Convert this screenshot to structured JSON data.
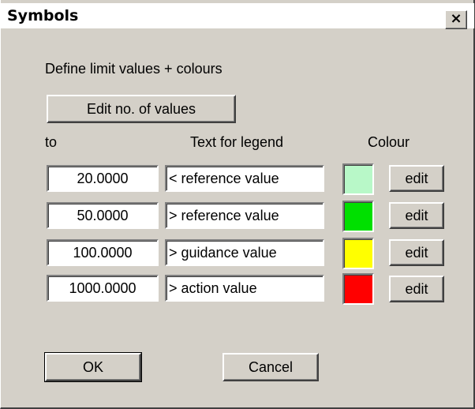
{
  "window": {
    "title": "Symbols",
    "close_label": "×"
  },
  "heading": "Define limit values + colours",
  "edit_values_label": "Edit no. of values",
  "columns": {
    "to": "to",
    "legend": "Text for legend",
    "colour": "Colour"
  },
  "rows": [
    {
      "to": "20.0000",
      "legend": "< reference value",
      "colour": "#b8f8c8",
      "edit_label": "edit"
    },
    {
      "to": "50.0000",
      "legend": "> reference value",
      "colour": "#00e000",
      "edit_label": "edit"
    },
    {
      "to": "100.0000",
      "legend": "> guidance value",
      "colour": "#ffff00",
      "edit_label": "edit"
    },
    {
      "to": "1000.0000",
      "legend": "> action value",
      "colour": "#ff0000",
      "edit_label": "edit"
    }
  ],
  "buttons": {
    "ok": "OK",
    "cancel": "Cancel"
  }
}
